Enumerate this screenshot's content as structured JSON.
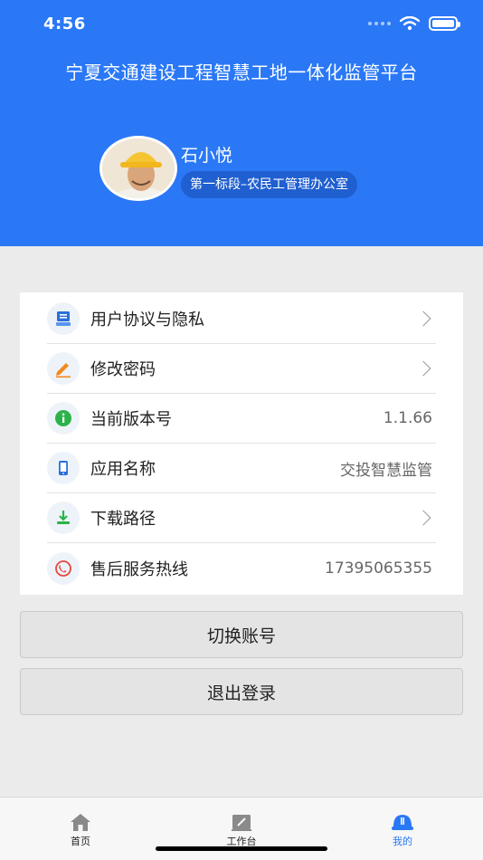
{
  "status": {
    "time": "4:56"
  },
  "header": {
    "title": "宁夏交通建设工程智慧工地一体化监管平台",
    "user_name": "石小悦",
    "department": "第一标段–农民工管理办公室"
  },
  "settings": [
    {
      "label": "用户协议与隐私",
      "value": "",
      "icon": "agreement-icon",
      "icon_color": "#2a6fdc",
      "arrow": true
    },
    {
      "label": "修改密码",
      "value": "",
      "icon": "pencil-icon",
      "icon_color": "#f08a1c",
      "arrow": true
    },
    {
      "label": "当前版本号",
      "value": "1.1.66",
      "icon": "info-icon",
      "icon_color": "#2bb34a",
      "arrow": false
    },
    {
      "label": "应用名称",
      "value": "交投智慧监管",
      "icon": "phone-icon",
      "icon_color": "#2a6fdc",
      "arrow": false
    },
    {
      "label": "下载路径",
      "value": "",
      "icon": "download-icon",
      "icon_color": "#2bb34a",
      "arrow": true
    },
    {
      "label": "售后服务热线",
      "value": "17395065355",
      "icon": "hotline-icon",
      "icon_color": "#e8473c",
      "arrow": false
    }
  ],
  "actions": {
    "switch_account": "切换账号",
    "logout": "退出登录"
  },
  "tabs": [
    {
      "label": "首页",
      "icon": "home-icon",
      "active": false
    },
    {
      "label": "工作台",
      "icon": "workbench-icon",
      "active": false
    },
    {
      "label": "我的",
      "icon": "helmet-icon",
      "active": true
    }
  ],
  "colors": {
    "primary": "#2a78f6",
    "badge": "#1f5fd0"
  }
}
